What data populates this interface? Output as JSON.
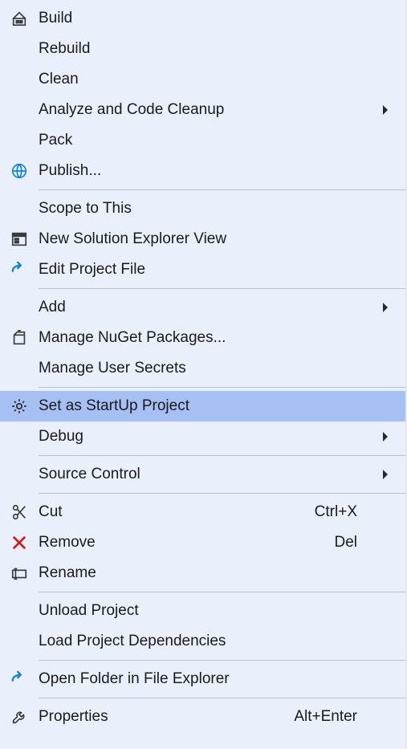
{
  "menu": {
    "items": [
      {
        "type": "item",
        "id": "build",
        "label": "Build",
        "icon": "build-icon"
      },
      {
        "type": "item",
        "id": "rebuild",
        "label": "Rebuild"
      },
      {
        "type": "item",
        "id": "clean",
        "label": "Clean"
      },
      {
        "type": "item",
        "id": "analyze-cleanup",
        "label": "Analyze and Code Cleanup",
        "submenu": true
      },
      {
        "type": "item",
        "id": "pack",
        "label": "Pack"
      },
      {
        "type": "item",
        "id": "publish",
        "label": "Publish...",
        "icon": "publish-icon",
        "iconColor": "#0a84d6"
      },
      {
        "type": "separator"
      },
      {
        "type": "item",
        "id": "scope-to-this",
        "label": "Scope to This"
      },
      {
        "type": "item",
        "id": "new-solution-explorer",
        "label": "New Solution Explorer View",
        "icon": "solution-explorer-icon"
      },
      {
        "type": "item",
        "id": "edit-project-file",
        "label": "Edit Project File",
        "icon": "edit-arrow-icon",
        "iconColor": "#0a84d6"
      },
      {
        "type": "separator"
      },
      {
        "type": "item",
        "id": "add",
        "label": "Add",
        "submenu": true
      },
      {
        "type": "item",
        "id": "manage-nuget",
        "label": "Manage NuGet Packages...",
        "icon": "nuget-icon"
      },
      {
        "type": "item",
        "id": "manage-user-secrets",
        "label": "Manage User Secrets"
      },
      {
        "type": "separator"
      },
      {
        "type": "item",
        "id": "set-startup-project",
        "label": "Set as StartUp Project",
        "icon": "gear-icon",
        "highlighted": true
      },
      {
        "type": "item",
        "id": "debug",
        "label": "Debug",
        "submenu": true
      },
      {
        "type": "separator"
      },
      {
        "type": "item",
        "id": "source-control",
        "label": "Source Control",
        "submenu": true
      },
      {
        "type": "separator"
      },
      {
        "type": "item",
        "id": "cut",
        "label": "Cut",
        "icon": "scissors-icon",
        "shortcut": "Ctrl+X"
      },
      {
        "type": "item",
        "id": "remove",
        "label": "Remove",
        "icon": "remove-x-icon",
        "iconColor": "#d21919",
        "shortcut": "Del"
      },
      {
        "type": "item",
        "id": "rename",
        "label": "Rename",
        "icon": "rename-icon"
      },
      {
        "type": "separator"
      },
      {
        "type": "item",
        "id": "unload-project",
        "label": "Unload Project"
      },
      {
        "type": "item",
        "id": "load-project-deps",
        "label": "Load Project Dependencies"
      },
      {
        "type": "separator"
      },
      {
        "type": "item",
        "id": "open-folder-explorer",
        "label": "Open Folder in File Explorer",
        "icon": "open-folder-arrow-icon",
        "iconColor": "#0a84d6"
      },
      {
        "type": "separator"
      },
      {
        "type": "item",
        "id": "properties",
        "label": "Properties",
        "icon": "wrench-icon",
        "shortcut": "Alt+Enter"
      }
    ]
  }
}
